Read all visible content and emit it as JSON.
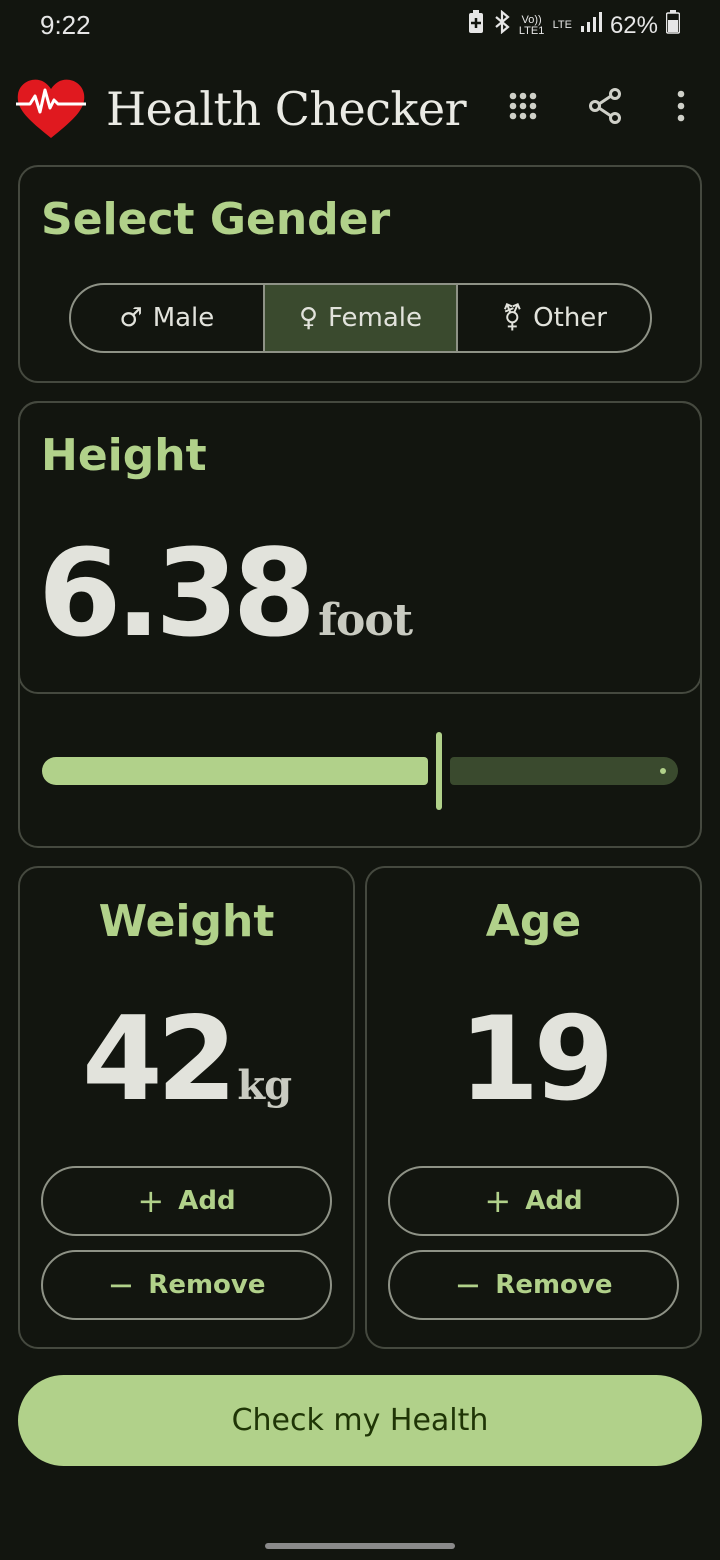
{
  "status_bar": {
    "time": "9:22",
    "volte": "Vo)) LTE1",
    "lte": "LTE",
    "battery_text": "62%",
    "icons": [
      "battery-saver-icon",
      "bluetooth-icon",
      "signal-icon",
      "battery-icon"
    ]
  },
  "app_bar": {
    "title": "Health Checker",
    "actions": [
      "apps-grid-icon",
      "share-icon",
      "more-vert-icon"
    ]
  },
  "gender": {
    "heading": "Select Gender",
    "options": [
      {
        "label": "Male",
        "symbol": "♂",
        "selected": false
      },
      {
        "label": "Female",
        "symbol": "♀",
        "selected": true
      },
      {
        "label": "Other",
        "symbol": "⚧",
        "selected": false
      }
    ]
  },
  "height": {
    "heading": "Height",
    "value": "6.38",
    "unit": "foot",
    "slider_fraction": 0.62
  },
  "weight": {
    "heading": "Weight",
    "value": "42",
    "unit": "kg",
    "add_label": "Add",
    "remove_label": "Remove"
  },
  "age": {
    "heading": "Age",
    "value": "19",
    "add_label": "Add",
    "remove_label": "Remove"
  },
  "check_button": "Check my Health",
  "colors": {
    "background": "#12150f",
    "accent": "#b1d18a",
    "selected_segment": "#3a4a2e",
    "heart": "#e0191f"
  }
}
